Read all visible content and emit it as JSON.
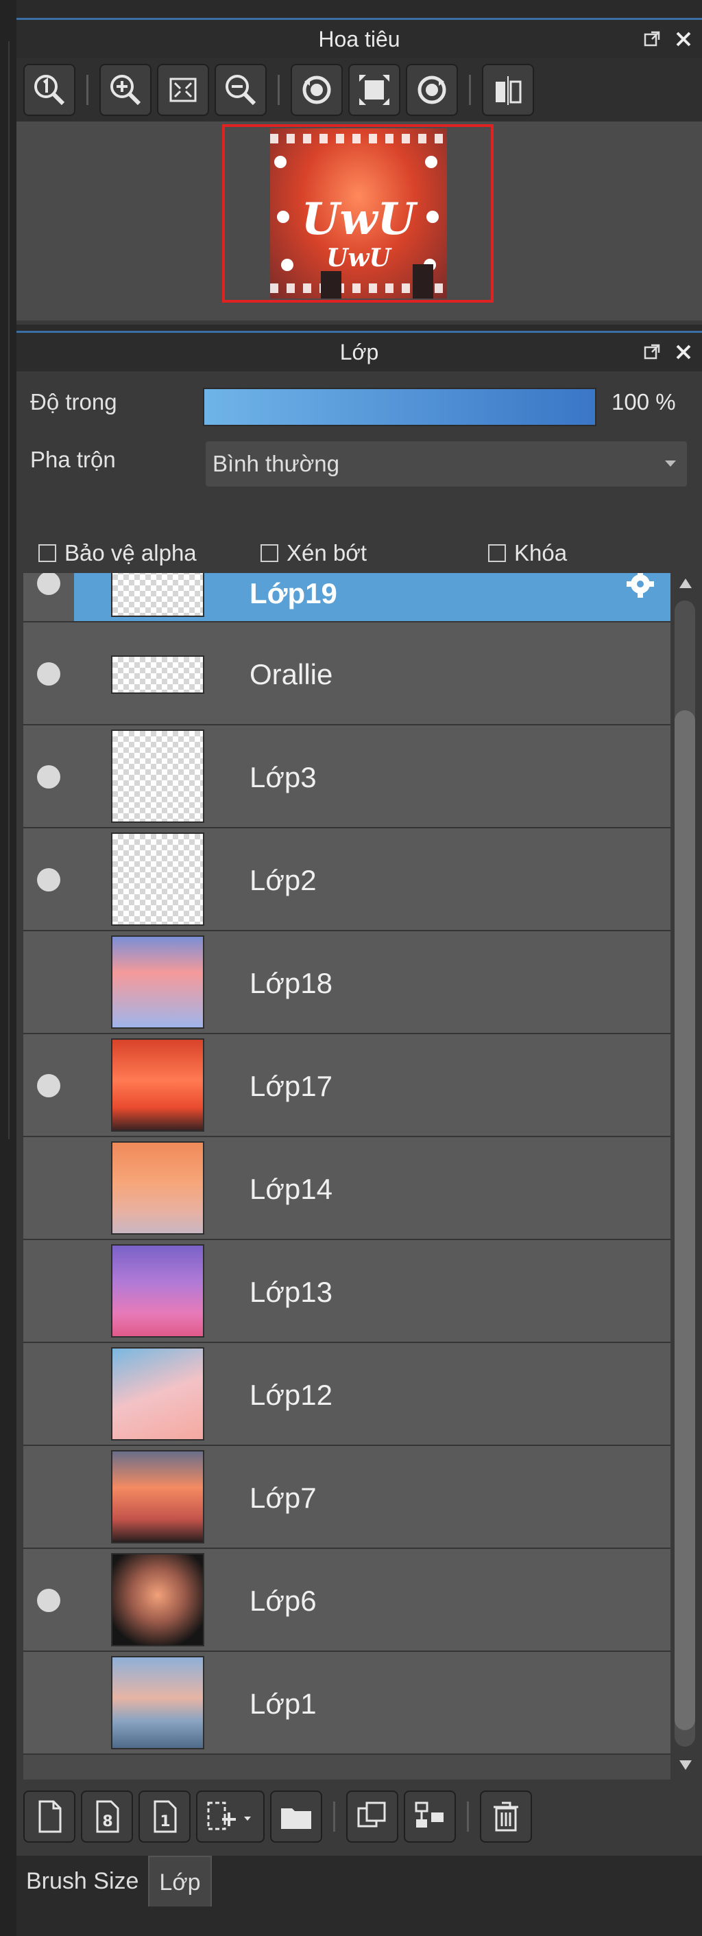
{
  "navigator": {
    "title": "Hoa tiêu",
    "thumbnail_text_large": "UwU",
    "thumbnail_text_small": "UwU"
  },
  "layer_panel": {
    "title": "Lớp",
    "opacity_label": "Độ trong",
    "opacity_value": "100 %",
    "opacity_percent": 100,
    "blend_label": "Pha trộn",
    "blend_value": "Bình thường",
    "checkboxes": {
      "protect_alpha": "Bảo vệ alpha",
      "clipping": "Xén bớt",
      "lock": "Khóa"
    },
    "layers": [
      {
        "name": "Lớp19",
        "visible": true,
        "selected": true
      },
      {
        "name": "Orallie",
        "visible": true
      },
      {
        "name": "Lớp3",
        "visible": true
      },
      {
        "name": "Lớp2",
        "visible": true
      },
      {
        "name": "Lớp18",
        "visible": false
      },
      {
        "name": "Lớp17",
        "visible": true
      },
      {
        "name": "Lớp14",
        "visible": false
      },
      {
        "name": "Lớp13",
        "visible": false
      },
      {
        "name": "Lớp12",
        "visible": false
      },
      {
        "name": "Lớp7",
        "visible": false
      },
      {
        "name": "Lớp6",
        "visible": true
      },
      {
        "name": "Lớp1",
        "visible": false
      }
    ]
  },
  "tabs": {
    "brush_size": "Brush Size",
    "layer": "Lớp"
  },
  "colors": {
    "accent": "#58a0d6",
    "panel": "#3a3a3a",
    "header": "#2c2c2c",
    "selected_layer": "#58a0d6"
  }
}
